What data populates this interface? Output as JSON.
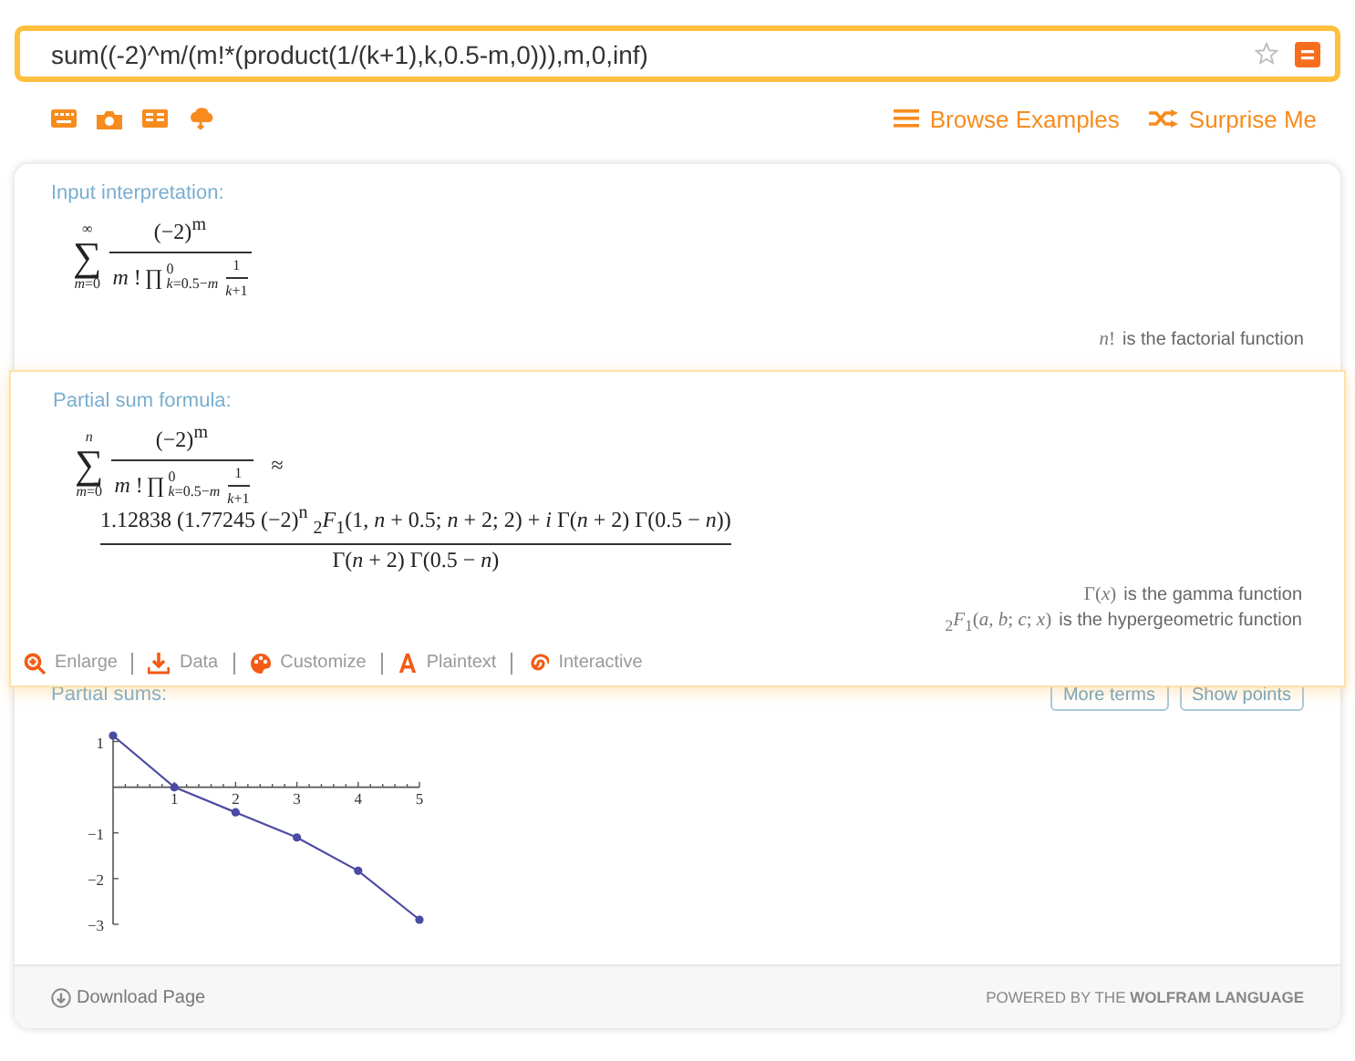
{
  "search": {
    "value": "sum((-2)^m/(m!*(product(1/(k+1),k,0.5-m,0))),m,0,inf)"
  },
  "links": [
    {
      "kind": "browse",
      "label": "Browse Examples"
    },
    {
      "kind": "surprise",
      "label": "Surprise Me"
    }
  ],
  "pods": [
    {
      "kind": "formula",
      "title": "Input interpretation:",
      "highlighted": false,
      "sum": {
        "operator": "∑",
        "upper": "∞",
        "lower": "*m*=0",
        "numerator": "(−2)$^{m}$",
        "den_prefix": "*m* !",
        "product": "∏",
        "prod_upper": "0",
        "prod_lower": "*k*=0.5−*m*",
        "frac_num": "1",
        "frac_den": "*k*+1"
      },
      "notes": [
        {
          "math": "*n*!",
          "text": "is the factorial function"
        }
      ]
    },
    {
      "kind": "formula",
      "title": "Partial sum formula:",
      "highlighted": true,
      "sum": {
        "operator": "∑",
        "upper": "*n*",
        "lower": "*m*=0",
        "numerator": "(−2)$^{m}$",
        "den_prefix": "*m* !",
        "product": "∏",
        "prod_upper": "0",
        "prod_lower": "*k*=0.5−*m*",
        "frac_num": "1",
        "frac_den": "*k*+1",
        "relation": "≈"
      },
      "result": {
        "numerator": "1.12838 (1.77245 (−2)$^{n}$ $_{2}$*F*$_{1}$(1, *n* + 0.5; *n* + 2; 2) + *i* Γ(*n* + 2) Γ(0.5 − *n*))",
        "denominator": "Γ(*n* + 2) Γ(0.5 − *n*)"
      },
      "notes": [
        {
          "math": "Γ(*x*)",
          "text": "is the gamma function"
        },
        {
          "math": "$_{2}$*F*$_{1}$(*a*, *b*; *c*; *x*)",
          "text": "is the hypergeometric function"
        }
      ],
      "actions": [
        {
          "kind": "enlarge",
          "label": "Enlarge"
        },
        {
          "kind": "data",
          "label": "Data"
        },
        {
          "kind": "customize",
          "label": "Customize"
        },
        {
          "kind": "plaintext",
          "label": "Plaintext"
        },
        {
          "kind": "interactive",
          "label": "Interactive"
        }
      ]
    },
    {
      "kind": "plot",
      "title": "Partial sums:",
      "highlighted": false,
      "buttons": [
        "More terms",
        "Show points"
      ],
      "chart_data": {
        "type": "line",
        "x": [
          0,
          1,
          2,
          3,
          4,
          5
        ],
        "xticks": [
          1,
          2,
          3,
          4,
          5
        ],
        "yticks": [
          1,
          -1,
          -2,
          -3
        ],
        "xlim": [
          0,
          5
        ],
        "ylim": [
          -3,
          1.15
        ],
        "series": [
          {
            "color": "#4b4ba3",
            "marker": "circle",
            "values": [
              1.13,
              0,
              -0.55,
              -1.1,
              -1.83,
              -2.9
            ]
          }
        ]
      }
    }
  ],
  "footer": {
    "download": "Download Page",
    "powered": "POWERED BY THE **WOLFRAM LANGUAGE**"
  }
}
